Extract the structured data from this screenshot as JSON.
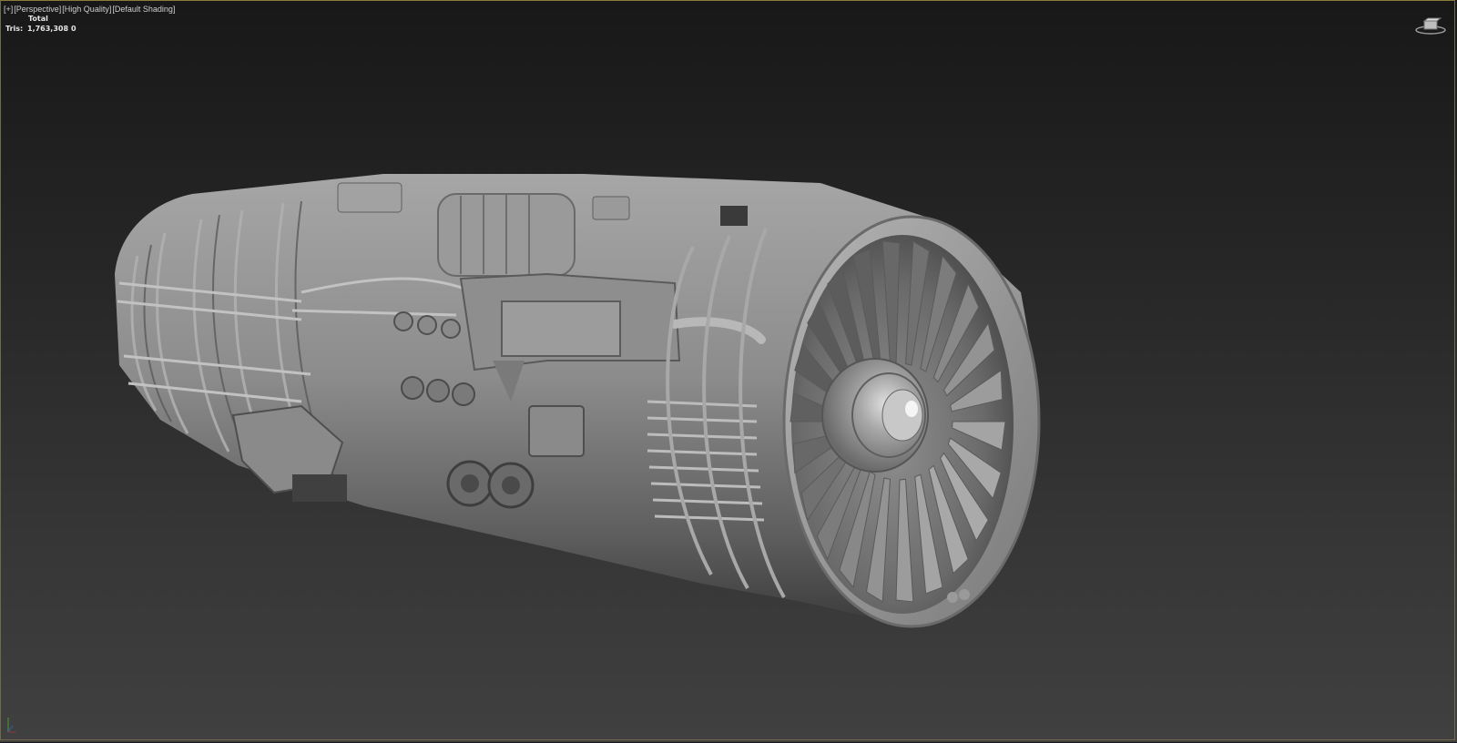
{
  "viewport": {
    "label_plus": "[+]",
    "label_view": "[Perspective]",
    "label_quality": "[High Quality]",
    "label_shading": "[Default Shading]"
  },
  "stats": {
    "header": "Total",
    "tris_label": "Tris:",
    "tris_total": "1,763,308",
    "tris_selected": "0"
  },
  "icons": {
    "viewcube": "viewcube-icon",
    "axis": "axis-gizmo-icon",
    "model": "jet-engine-model"
  },
  "colors": {
    "viewport_border": "#8a7d3a",
    "model_base": "#8a8a8a"
  }
}
